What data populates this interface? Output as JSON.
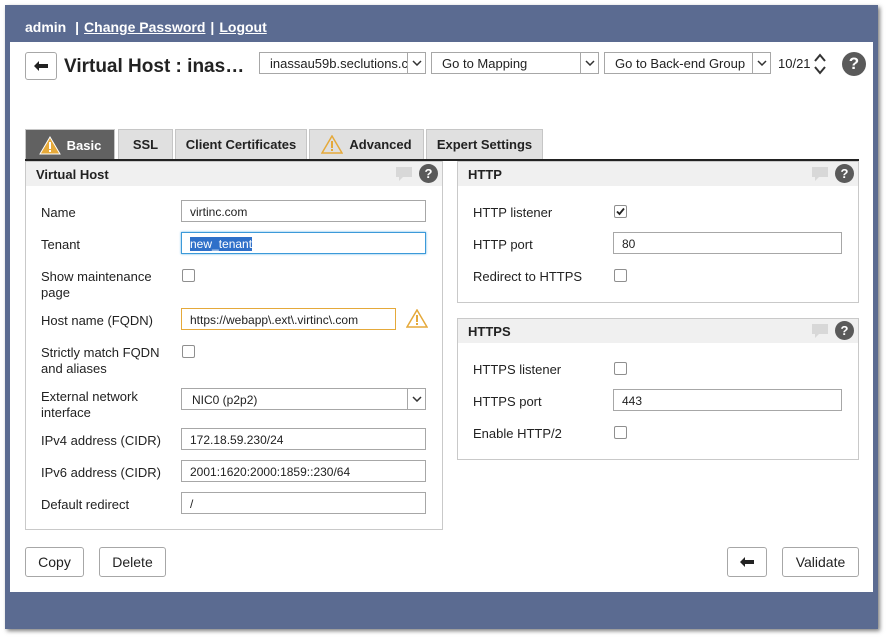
{
  "topbar": {
    "user": "admin",
    "change_password": "Change Password",
    "logout": "Logout",
    "separator": "|"
  },
  "header": {
    "title": "Virtual Host : inassa…",
    "host_select": "inassau59b.seclutions.c",
    "mapping_select": "Go to Mapping",
    "backend_select": "Go to Back-end Group",
    "counter": "10/21",
    "help": "?"
  },
  "tabs": [
    {
      "label": "Basic",
      "warning": true,
      "active": true
    },
    {
      "label": "SSL",
      "warning": false,
      "active": false
    },
    {
      "label": "Client Certificates",
      "warning": false,
      "active": false
    },
    {
      "label": "Advanced",
      "warning": true,
      "active": false
    },
    {
      "label": "Expert Settings",
      "warning": false,
      "active": false
    }
  ],
  "virtual_host": {
    "title": "Virtual Host",
    "name_label": "Name",
    "name_value": "virtinc.com",
    "tenant_label": "Tenant",
    "tenant_value": "new_tenant",
    "maintenance_label_1": "Show maintenance",
    "maintenance_label_2": "page",
    "fqdn_label": "Host name (FQDN)",
    "fqdn_value": "https://webapp\\.ext\\.virtinc\\.com",
    "strict_label_1": "Strictly match FQDN",
    "strict_label_2": "and aliases",
    "ext_if_label_1": "External network",
    "ext_if_label_2": "interface",
    "ext_if_value": "NIC0 (p2p2)",
    "ipv4_label": "IPv4 address (CIDR)",
    "ipv4_value": "172.18.59.230/24",
    "ipv6_label": "IPv6 address (CIDR)",
    "ipv6_value": "2001:1620:2000:1859::230/64",
    "redirect_label": "Default redirect",
    "redirect_value": "/"
  },
  "http": {
    "title": "HTTP",
    "listener_label": "HTTP listener",
    "listener_checked": true,
    "port_label": "HTTP port",
    "port_value": "80",
    "redirect_label": "Redirect to HTTPS",
    "redirect_checked": false
  },
  "https": {
    "title": "HTTPS",
    "listener_label": "HTTPS listener",
    "listener_checked": false,
    "port_label": "HTTPS port",
    "port_value": "443",
    "http2_label": "Enable HTTP/2",
    "http2_checked": false
  },
  "footer": {
    "copy": "Copy",
    "delete": "Delete",
    "validate": "Validate"
  },
  "colors": {
    "frame": "#5b6b91",
    "active_tab": "#616161",
    "warning": "#e5a93a",
    "focus": "#3c9ad9"
  }
}
